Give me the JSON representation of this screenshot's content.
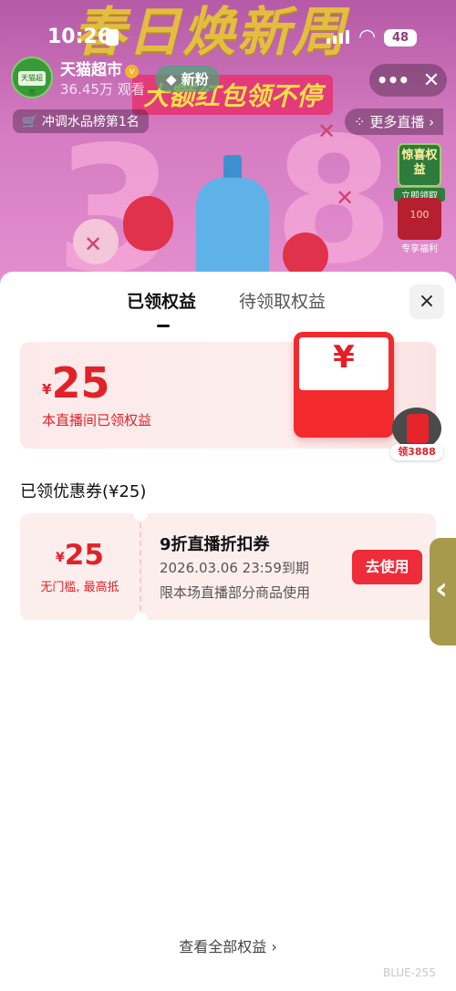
{
  "status_bar": {
    "time": "10:26",
    "battery": "48"
  },
  "stream": {
    "banner_title": "春日焕新周",
    "banner_subtitle": "大额红包领不停",
    "big_digit_left": "3",
    "big_digit_right": "8",
    "streamer_name": "天猫超市",
    "verified_mark": "v",
    "viewers": "36.45万 观看",
    "new_fans_label": "新粉",
    "rank_label": "冲调水品榜第1名",
    "more_live_label": "更多直播",
    "side_card_1_title": "惊喜权益",
    "side_card_1_footer": "立即领取",
    "side_card_2_title": "100",
    "side_card_2_footer": "专享福利",
    "avatar_text": "天猫超市"
  },
  "sheet": {
    "tabs": [
      {
        "label": "已领权益",
        "active": true
      },
      {
        "label": "待领取权益",
        "active": false
      }
    ],
    "close_icon": "×",
    "summary": {
      "currency": "¥",
      "amount": "25",
      "label": "本直播间已领权益",
      "envelope_icon": "¥"
    },
    "float_badge": {
      "label": "领3888"
    },
    "coupon_section_title": "已领优惠券(¥25)",
    "coupons": [
      {
        "currency": "¥",
        "amount": "25",
        "condition": "无门槛, 最高抵",
        "name": "9折直播折扣券",
        "expiry": "2026.03.06 23:59到期",
        "scope": "限本场直播部分商品使用",
        "action_label": "去使用"
      }
    ],
    "view_all_label": "查看全部权益 ›",
    "watermark": "BLUE-255"
  },
  "colors": {
    "accent_red": "#e02228",
    "button_red": "#ee2c3a",
    "coupon_bg": "#fdeeee"
  },
  "icons": {
    "close": "close-icon",
    "more": "more-dots-icon",
    "wifi": "wifi-icon",
    "chevron": "chevron-left-icon",
    "envelope": "red-envelope-icon"
  }
}
